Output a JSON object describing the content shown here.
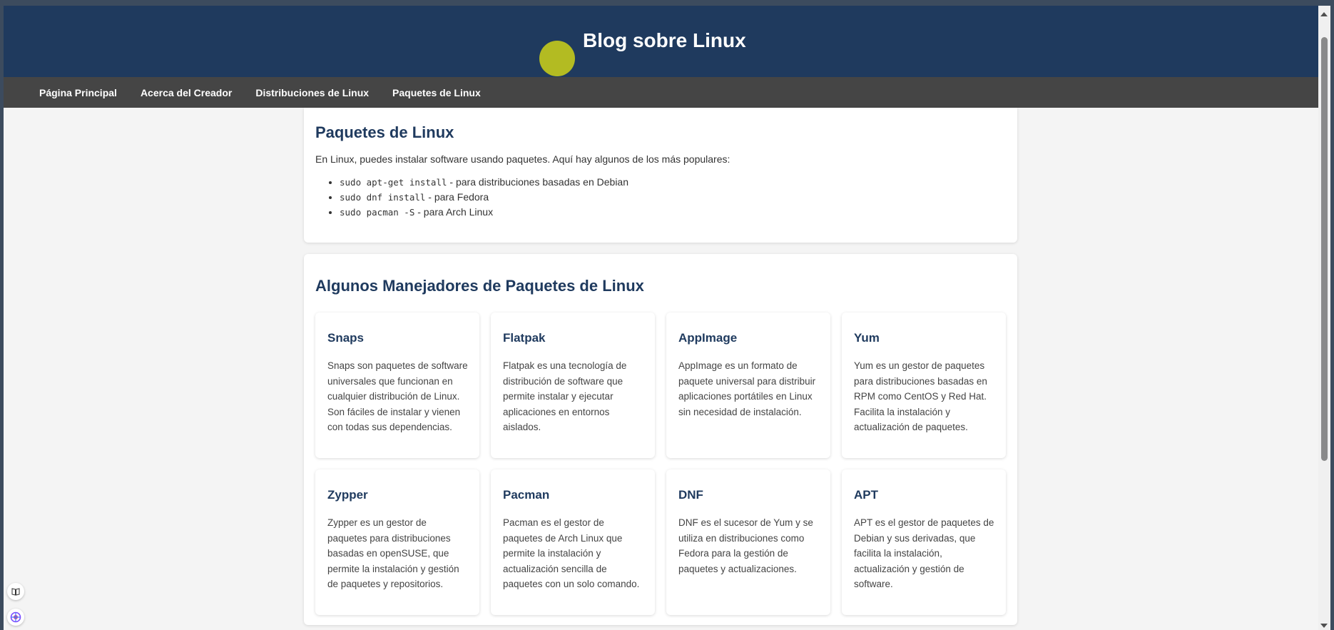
{
  "header": {
    "title": "Blog sobre Linux"
  },
  "nav": {
    "items": [
      {
        "label": "Página Principal"
      },
      {
        "label": "Acerca del Creador"
      },
      {
        "label": "Distribuciones de Linux"
      },
      {
        "label": "Paquetes de Linux"
      }
    ]
  },
  "intro": {
    "title": "Paquetes de Linux",
    "text": "En Linux, puedes instalar software usando paquetes. Aquí hay algunos de los más populares:",
    "commands": [
      {
        "code": "sudo apt-get install",
        "desc": " - para distribuciones basadas en Debian"
      },
      {
        "code": "sudo dnf install",
        "desc": " - para Fedora"
      },
      {
        "code": "sudo pacman -S",
        "desc": " - para Arch Linux"
      }
    ]
  },
  "managers": {
    "title": "Algunos Manejadores de Paquetes de Linux",
    "items": [
      {
        "name": "Snaps",
        "desc": "Snaps son paquetes de software universales que funcionan en cualquier distribución de Linux. Son fáciles de instalar y vienen con todas sus dependencias."
      },
      {
        "name": "Flatpak",
        "desc": "Flatpak es una tecnología de distribución de software que permite instalar y ejecutar aplicaciones en entornos aislados."
      },
      {
        "name": "AppImage",
        "desc": "AppImage es un formato de paquete universal para distribuir aplicaciones portátiles en Linux sin necesidad de instalación."
      },
      {
        "name": "Yum",
        "desc": "Yum es un gestor de paquetes para distribuciones basadas en RPM como CentOS y Red Hat. Facilita la instalación y actualización de paquetes."
      },
      {
        "name": "Zypper",
        "desc": "Zypper es un gestor de paquetes para distribuciones basadas en openSUSE, que permite la instalación y gestión de paquetes y repositorios."
      },
      {
        "name": "Pacman",
        "desc": "Pacman es el gestor de paquetes de Arch Linux que permite la instalación y actualización sencilla de paquetes con un solo comando."
      },
      {
        "name": "DNF",
        "desc": "DNF es el sucesor de Yum y se utiliza en distribuciones como Fedora para la gestión de paquetes y actualizaciones."
      },
      {
        "name": "APT",
        "desc": "APT es el gestor de paquetes de Debian y sus derivadas, que facilita la instalación, actualización y gestión de software."
      }
    ]
  },
  "colors": {
    "header_bg": "#1f3a5e",
    "nav_bg": "#454545",
    "logo": "#b3bb22"
  },
  "icons": [
    "reader-icon",
    "ai-assistant-icon"
  ]
}
